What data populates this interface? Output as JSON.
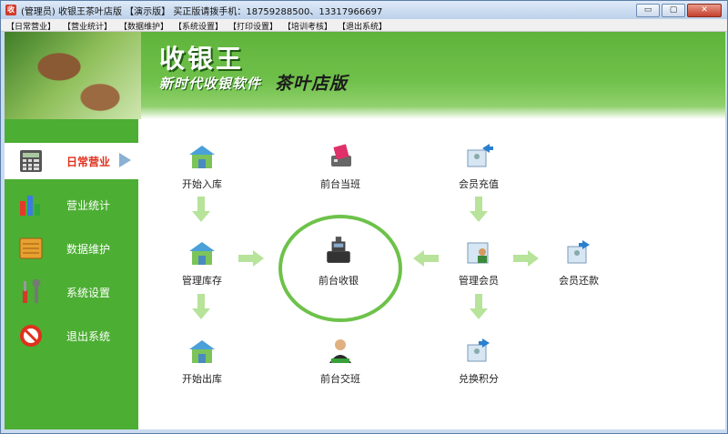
{
  "window": {
    "title": "(管理员) 收银王茶叶店版  【演示版】  买正版请拨手机：18759288500、13317966697",
    "app_icon": "收",
    "buttons": {
      "minimize": "▭",
      "maximize": "▢",
      "close": "✕"
    }
  },
  "menu": [
    "【日常营业】",
    "【营业统计】",
    "【数据维护】",
    "【系统设置】",
    "【打印设置】",
    "【培训考核】",
    "【退出系统】"
  ],
  "banner": {
    "title": "收银王",
    "subtitle_left": "新时代收银软件",
    "subtitle_right": "茶叶店版"
  },
  "sidebar": [
    {
      "label": "日常营业",
      "icon": "calculator-icon",
      "active": true
    },
    {
      "label": "营业统计",
      "icon": "bar-chart-icon",
      "active": false
    },
    {
      "label": "数据维护",
      "icon": "database-box-icon",
      "active": false
    },
    {
      "label": "系统设置",
      "icon": "tools-icon",
      "active": false
    },
    {
      "label": "退出系统",
      "icon": "no-entry-icon",
      "active": false
    }
  ],
  "nodes": {
    "start_stock_in": "开始入库",
    "front_shift_on": "前台当班",
    "member_recharge": "会员充值",
    "manage_inventory": "管理库存",
    "front_cashier": "前台收银",
    "manage_members": "管理会员",
    "member_repay": "会员还款",
    "start_stock_out": "开始出库",
    "front_shift_handover": "前台交班",
    "redeem_points": "兑换积分"
  },
  "colors": {
    "primary_green": "#4cae33",
    "active_label": "#e0301e",
    "arrow_green": "#b7e39a"
  }
}
